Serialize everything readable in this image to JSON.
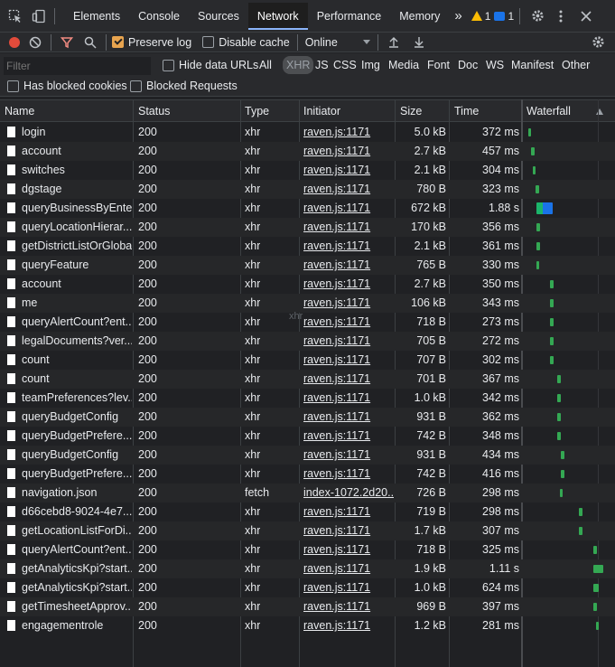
{
  "tabs": {
    "elements": "Elements",
    "console": "Console",
    "sources": "Sources",
    "network": "Network",
    "performance": "Performance",
    "memory": "Memory",
    "more": "»",
    "warnings_count": "1",
    "messages_count": "1"
  },
  "toolbar": {
    "preserve_log": "Preserve log",
    "disable_cache": "Disable cache",
    "throttle": "Online"
  },
  "filter": {
    "placeholder": "Filter",
    "hide_data_urls": "Hide data URLs",
    "types": [
      "All",
      "XHR",
      "JS",
      "CSS",
      "Img",
      "Media",
      "Font",
      "Doc",
      "WS",
      "Manifest",
      "Other"
    ],
    "has_blocked_cookies": "Has blocked cookies",
    "blocked_requests": "Blocked Requests"
  },
  "columns": {
    "name": "Name",
    "status": "Status",
    "type": "Type",
    "initiator": "Initiator",
    "size": "Size",
    "time": "Time",
    "waterfall": "Waterfall"
  },
  "drag_ghost": "xhr",
  "colors": {
    "accent_checkbox": "#e8a44f",
    "waterfall_green": "#34a853",
    "waterfall_blue": "#1a73e8",
    "record": "#e24b3b"
  },
  "rows": [
    {
      "name": "login",
      "status": "200",
      "type": "xhr",
      "initiator": "raven.js:1171",
      "size": "5.0 kB",
      "time": "372 ms",
      "wf_start": 0.02,
      "wf_len": 0.04
    },
    {
      "name": "account",
      "status": "200",
      "type": "xhr",
      "initiator": "raven.js:1171",
      "size": "2.7 kB",
      "time": "457 ms",
      "wf_start": 0.06,
      "wf_len": 0.05
    },
    {
      "name": "switches",
      "status": "200",
      "type": "xhr",
      "initiator": "raven.js:1171",
      "size": "2.1 kB",
      "time": "304 ms",
      "wf_start": 0.09,
      "wf_len": 0.04
    },
    {
      "name": "dgstage",
      "status": "200",
      "type": "xhr",
      "initiator": "raven.js:1171",
      "size": "780 B",
      "time": "323 ms",
      "wf_start": 0.13,
      "wf_len": 0.04
    },
    {
      "name": "queryBusinessByEnte...",
      "status": "200",
      "type": "xhr",
      "initiator": "raven.js:1171",
      "size": "672 kB",
      "time": "1.88 s",
      "wf_start": 0.14,
      "wf_len": 0.22,
      "big": true
    },
    {
      "name": "queryLocationHierar...",
      "status": "200",
      "type": "xhr",
      "initiator": "raven.js:1171",
      "size": "170 kB",
      "time": "356 ms",
      "wf_start": 0.14,
      "wf_len": 0.05
    },
    {
      "name": "getDistrictListOrGlobal",
      "status": "200",
      "type": "xhr",
      "initiator": "raven.js:1171",
      "size": "2.1 kB",
      "time": "361 ms",
      "wf_start": 0.14,
      "wf_len": 0.05
    },
    {
      "name": "queryFeature",
      "status": "200",
      "type": "xhr",
      "initiator": "raven.js:1171",
      "size": "765 B",
      "time": "330 ms",
      "wf_start": 0.14,
      "wf_len": 0.04
    },
    {
      "name": "account",
      "status": "200",
      "type": "xhr",
      "initiator": "raven.js:1171",
      "size": "2.7 kB",
      "time": "350 ms",
      "wf_start": 0.33,
      "wf_len": 0.04
    },
    {
      "name": "me",
      "status": "200",
      "type": "xhr",
      "initiator": "raven.js:1171",
      "size": "106 kB",
      "time": "343 ms",
      "wf_start": 0.33,
      "wf_len": 0.04
    },
    {
      "name": "queryAlertCount?ent...",
      "status": "200",
      "type": "xhr",
      "initiator": "raven.js:1171",
      "size": "718 B",
      "time": "273 ms",
      "wf_start": 0.33,
      "wf_len": 0.04
    },
    {
      "name": "legalDocuments?ver...",
      "status": "200",
      "type": "xhr",
      "initiator": "raven.js:1171",
      "size": "705 B",
      "time": "272 ms",
      "wf_start": 0.33,
      "wf_len": 0.04
    },
    {
      "name": "count",
      "status": "200",
      "type": "xhr",
      "initiator": "raven.js:1171",
      "size": "707 B",
      "time": "302 ms",
      "wf_start": 0.33,
      "wf_len": 0.04
    },
    {
      "name": "count",
      "status": "200",
      "type": "xhr",
      "initiator": "raven.js:1171",
      "size": "701 B",
      "time": "367 ms",
      "wf_start": 0.43,
      "wf_len": 0.05
    },
    {
      "name": "teamPreferences?lev...",
      "status": "200",
      "type": "xhr",
      "initiator": "raven.js:1171",
      "size": "1.0 kB",
      "time": "342 ms",
      "wf_start": 0.43,
      "wf_len": 0.04
    },
    {
      "name": "queryBudgetConfig",
      "status": "200",
      "type": "xhr",
      "initiator": "raven.js:1171",
      "size": "931 B",
      "time": "362 ms",
      "wf_start": 0.43,
      "wf_len": 0.04
    },
    {
      "name": "queryBudgetPrefere...",
      "status": "200",
      "type": "xhr",
      "initiator": "raven.js:1171",
      "size": "742 B",
      "time": "348 ms",
      "wf_start": 0.43,
      "wf_len": 0.04
    },
    {
      "name": "queryBudgetConfig",
      "status": "200",
      "type": "xhr",
      "initiator": "raven.js:1171",
      "size": "931 B",
      "time": "434 ms",
      "wf_start": 0.48,
      "wf_len": 0.05
    },
    {
      "name": "queryBudgetPrefere...",
      "status": "200",
      "type": "xhr",
      "initiator": "raven.js:1171",
      "size": "742 B",
      "time": "416 ms",
      "wf_start": 0.48,
      "wf_len": 0.05
    },
    {
      "name": "navigation.json",
      "status": "200",
      "type": "fetch",
      "initiator": "index-1072.2d20...",
      "size": "726 B",
      "time": "298 ms",
      "wf_start": 0.46,
      "wf_len": 0.04
    },
    {
      "name": "d66cebd8-9024-4e7...",
      "status": "200",
      "type": "xhr",
      "initiator": "raven.js:1171",
      "size": "719 B",
      "time": "298 ms",
      "wf_start": 0.73,
      "wf_len": 0.04
    },
    {
      "name": "getLocationListForDi...",
      "status": "200",
      "type": "xhr",
      "initiator": "raven.js:1171",
      "size": "1.7 kB",
      "time": "307 ms",
      "wf_start": 0.73,
      "wf_len": 0.04
    },
    {
      "name": "queryAlertCount?ent...",
      "status": "200",
      "type": "xhr",
      "initiator": "raven.js:1171",
      "size": "718 B",
      "time": "325 ms",
      "wf_start": 0.93,
      "wf_len": 0.05
    },
    {
      "name": "getAnalyticsKpi?start...",
      "status": "200",
      "type": "xhr",
      "initiator": "raven.js:1171",
      "size": "1.9 kB",
      "time": "1.11 s",
      "wf_start": 0.93,
      "wf_len": 0.13
    },
    {
      "name": "getAnalyticsKpi?start...",
      "status": "200",
      "type": "xhr",
      "initiator": "raven.js:1171",
      "size": "1.0 kB",
      "time": "624 ms",
      "wf_start": 0.93,
      "wf_len": 0.07
    },
    {
      "name": "getTimesheetApprov...",
      "status": "200",
      "type": "xhr",
      "initiator": "raven.js:1171",
      "size": "969 B",
      "time": "397 ms",
      "wf_start": 0.93,
      "wf_len": 0.05
    },
    {
      "name": "engagementrole",
      "status": "200",
      "type": "xhr",
      "initiator": "raven.js:1171",
      "size": "1.2 kB",
      "time": "281 ms",
      "wf_start": 0.96,
      "wf_len": 0.04
    }
  ]
}
